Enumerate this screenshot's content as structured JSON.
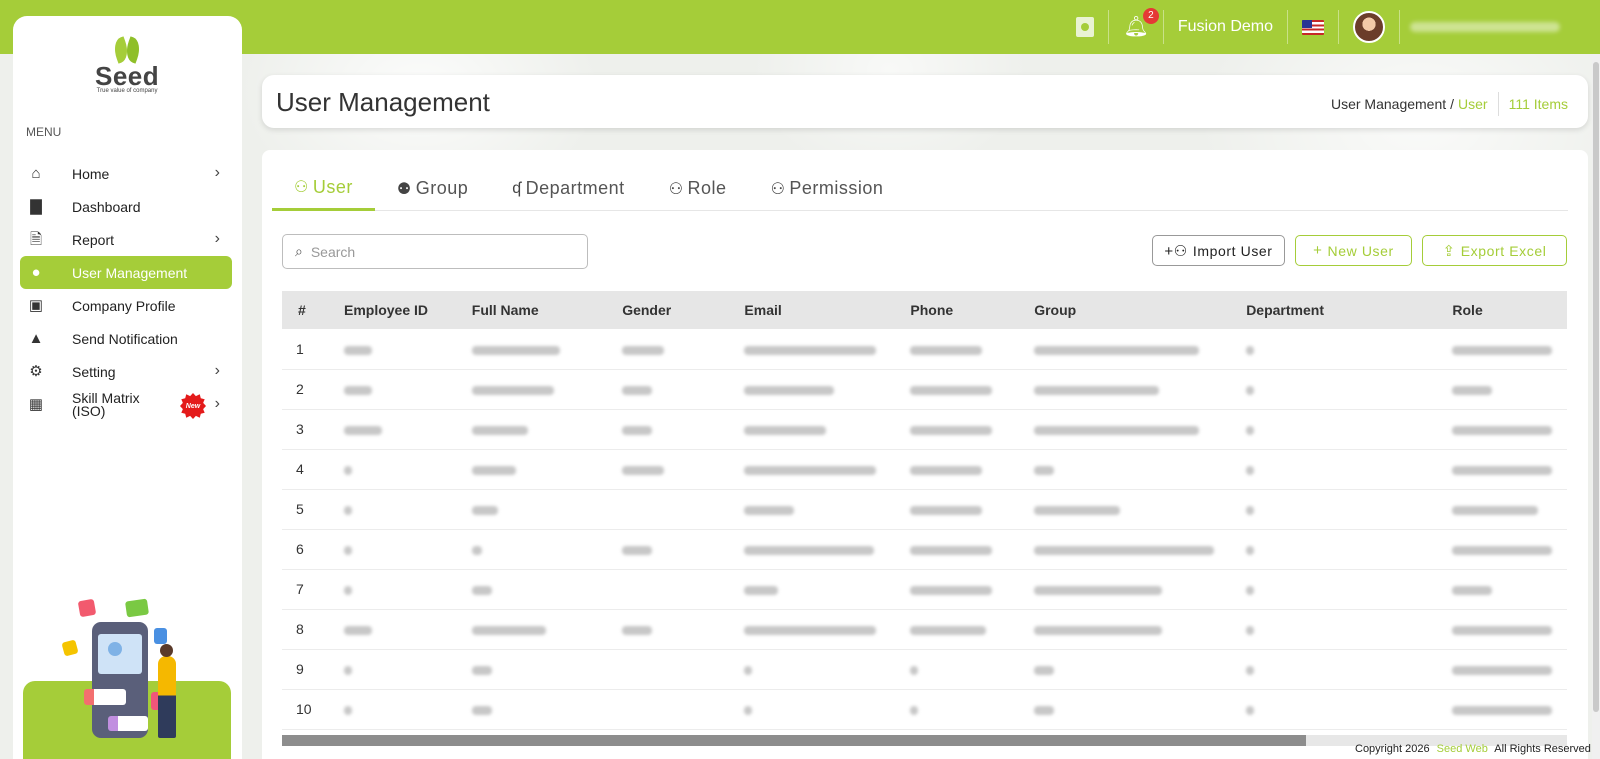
{
  "topbar": {
    "notification_count": "2",
    "company": "Fusion Demo",
    "flag": "us-flag-icon",
    "accent_color": "#a5cd39"
  },
  "sidebar": {
    "logo_name": "Seed",
    "logo_tagline": "True value of company",
    "menu_title": "MENU",
    "items": [
      {
        "label": "Home",
        "icon": "home-icon",
        "chevron": true
      },
      {
        "label": "Dashboard",
        "icon": "bar-chart-icon",
        "chevron": false
      },
      {
        "label": "Report",
        "icon": "document-icon",
        "chevron": true
      },
      {
        "label": "User Management",
        "icon": "user-icon",
        "chevron": false,
        "active": true
      },
      {
        "label": "Company Profile",
        "icon": "briefcase-icon",
        "chevron": false
      },
      {
        "label": "Send Notification",
        "icon": "bell-icon",
        "chevron": false
      },
      {
        "label": "Setting",
        "icon": "gear-icon",
        "chevron": true
      },
      {
        "label_line1": "Skill Matrix",
        "label_line2": "(ISO)",
        "icon": "skill-icon",
        "chevron": true,
        "badge": "New"
      }
    ]
  },
  "header": {
    "title": "User Management",
    "breadcrumb_root": "User Management",
    "breadcrumb_sep": "/",
    "breadcrumb_current": "User",
    "item_count": "111 Items"
  },
  "tabs": [
    {
      "label": "User",
      "icon": "user-outline-icon",
      "active": true
    },
    {
      "label": "Group",
      "icon": "group-icon"
    },
    {
      "label": "Department",
      "icon": "hierarchy-icon"
    },
    {
      "label": "Role",
      "icon": "user-role-icon"
    },
    {
      "label": "Permission",
      "icon": "user-lock-icon"
    }
  ],
  "toolbar": {
    "search_placeholder": "Search",
    "import_label": "Import User",
    "new_label": "New User",
    "export_label": "Export Excel"
  },
  "table": {
    "columns": [
      "#",
      "Employee ID",
      "Full Name",
      "Gender",
      "Email",
      "Phone",
      "Group",
      "Department",
      "Role"
    ],
    "row_numbers": [
      "1",
      "2",
      "3",
      "4",
      "5",
      "6",
      "7",
      "8",
      "9",
      "10"
    ]
  },
  "footer": {
    "copyright": "Copyright 2026",
    "brand": "Seed Web",
    "rights": "All Rights Reserved"
  }
}
